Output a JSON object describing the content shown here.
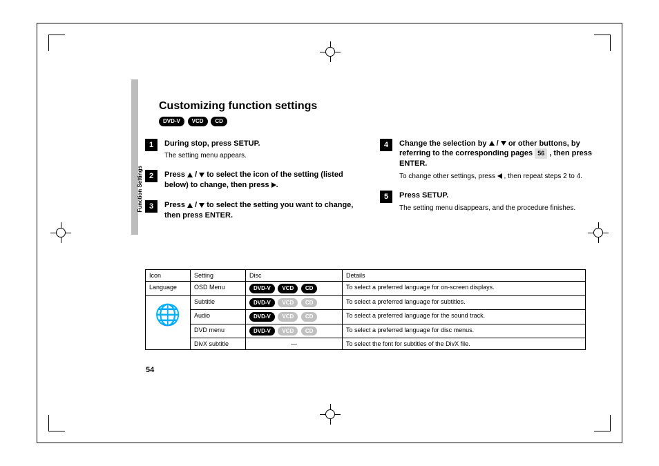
{
  "section_tab": "Function Settings",
  "title": "Customizing function settings",
  "disc_badges": [
    "DVD-V",
    "VCD",
    "CD"
  ],
  "steps": [
    {
      "num": "1",
      "title_pre": "During stop, press SETUP.",
      "sub": "The setting menu appears."
    },
    {
      "num": "2",
      "title_pre": "Press ",
      "title_mid": " to select the icon of the setting (listed below) to change, then press ",
      "title_post": "."
    },
    {
      "num": "3",
      "title_pre": "Press ",
      "title_mid": " to select the setting you want to change, then press ENTER."
    },
    {
      "num": "4",
      "title_pre": "Change the selection by ",
      "title_mid": " or other buttons, by referring to the corresponding pages ",
      "page_ref": "56",
      "title_post": " , then press ENTER.",
      "sub_pre": "To change other settings, press ",
      "sub_post": " , then repeat steps 2 to 4."
    },
    {
      "num": "5",
      "title_pre": "Press SETUP.",
      "sub": "The setting menu disappears, and the procedure finishes."
    }
  ],
  "table": {
    "headers": [
      "Icon",
      "Setting",
      "Disc",
      "Details"
    ],
    "category": "Language",
    "rows": [
      {
        "setting": "OSD Menu",
        "disc": [
          [
            "DVD-V",
            "on"
          ],
          [
            "VCD",
            "on"
          ],
          [
            "CD",
            "on"
          ]
        ],
        "details": "To select a preferred language for on-screen displays."
      },
      {
        "setting": "Subtitle",
        "disc": [
          [
            "DVD-V",
            "on"
          ],
          [
            "VCD",
            "off"
          ],
          [
            "CD",
            "off"
          ]
        ],
        "details": "To select a preferred language for subtitles."
      },
      {
        "setting": "Audio",
        "disc": [
          [
            "DVD-V",
            "on"
          ],
          [
            "VCD",
            "off"
          ],
          [
            "CD",
            "off"
          ]
        ],
        "details": "To select a preferred language for the sound track."
      },
      {
        "setting": "DVD menu",
        "disc": [
          [
            "DVD-V",
            "on"
          ],
          [
            "VCD",
            "off"
          ],
          [
            "CD",
            "off"
          ]
        ],
        "details": "To select a preferred language for disc menus."
      },
      {
        "setting": "DivX subtitle",
        "disc": null,
        "dash": "—",
        "details": "To select the font for subtitles of the DivX file."
      }
    ]
  },
  "page_number": "54"
}
